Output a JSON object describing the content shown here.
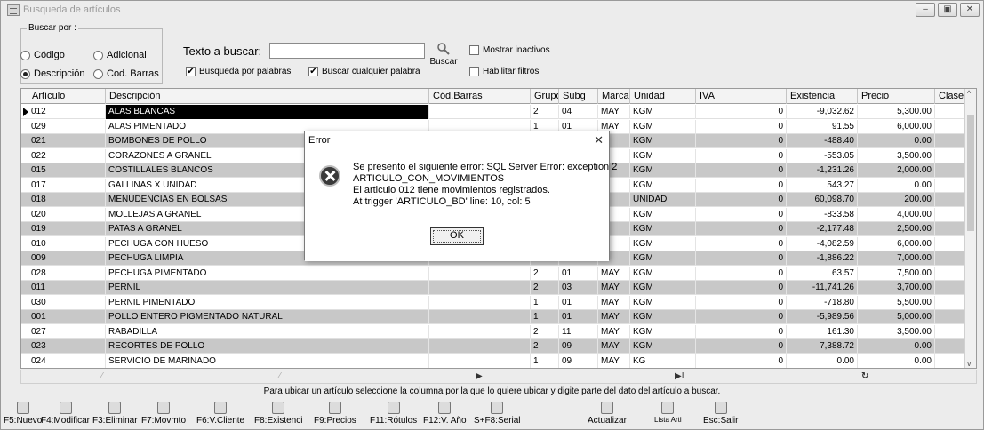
{
  "window": {
    "title": "Busqueda de artículos",
    "controls": [
      "minimize-icon",
      "restore-icon",
      "close-icon"
    ]
  },
  "search": {
    "group_label": "Buscar por :",
    "options": [
      {
        "label": "Código",
        "checked": false
      },
      {
        "label": "Adicional",
        "checked": false
      },
      {
        "label": "Descripción",
        "checked": true
      },
      {
        "label": "Cod. Barras",
        "checked": false
      }
    ],
    "text_label": "Texto a buscar:",
    "text_value": "",
    "by_words_label": "Busqueda por palabras",
    "by_words_checked": true,
    "any_word_label": "Buscar cualquier palabra",
    "any_word_checked": true,
    "button_label": "Buscar",
    "show_inactive_label": "Mostrar inactivos",
    "show_inactive_checked": false,
    "filters_label": "Habilitar filtros",
    "filters_checked": false
  },
  "grid": {
    "columns": [
      "Artículo",
      "Descripción",
      "Cód.Barras",
      "Grupo",
      "Subg",
      "Marca",
      "Unidad",
      "IVA",
      "Existencia",
      "Precio",
      "Clase"
    ],
    "rows": [
      {
        "articulo": "012",
        "descripcion": "ALAS BLANCAS",
        "barras": "",
        "grupo": "2",
        "subg": "04",
        "marca": "MAY",
        "unidad": "KGM",
        "iva": "0",
        "existencia": "-9,032.62",
        "precio": "5,300.00"
      },
      {
        "articulo": "029",
        "descripcion": "ALAS PIMENTADO",
        "barras": "",
        "grupo": "1",
        "subg": "01",
        "marca": "MAY",
        "unidad": "KGM",
        "iva": "0",
        "existencia": "91.55",
        "precio": "6,000.00"
      },
      {
        "articulo": "021",
        "descripcion": "BOMBONES DE POLLO",
        "barras": "",
        "grupo": "",
        "subg": "",
        "marca": "Y",
        "unidad": "KGM",
        "iva": "0",
        "existencia": "-488.40",
        "precio": "0.00"
      },
      {
        "articulo": "022",
        "descripcion": "CORAZONES A GRANEL",
        "barras": "",
        "grupo": "",
        "subg": "",
        "marca": "Y",
        "unidad": "KGM",
        "iva": "0",
        "existencia": "-553.05",
        "precio": "3,500.00"
      },
      {
        "articulo": "015",
        "descripcion": "COSTILLALES BLANCOS",
        "barras": "",
        "grupo": "",
        "subg": "",
        "marca": "Y",
        "unidad": "KGM",
        "iva": "0",
        "existencia": "-1,231.26",
        "precio": "2,000.00"
      },
      {
        "articulo": "017",
        "descripcion": "GALLINAS X UNIDAD",
        "barras": "",
        "grupo": "",
        "subg": "",
        "marca": "Y",
        "unidad": "KGM",
        "iva": "0",
        "existencia": "543.27",
        "precio": "0.00"
      },
      {
        "articulo": "018",
        "descripcion": "MENUDENCIAS EN BOLSAS",
        "barras": "",
        "grupo": "",
        "subg": "",
        "marca": "Y",
        "unidad": "UNIDAD",
        "iva": "0",
        "existencia": "60,098.70",
        "precio": "200.00"
      },
      {
        "articulo": "020",
        "descripcion": "MOLLEJAS A GRANEL",
        "barras": "",
        "grupo": "",
        "subg": "",
        "marca": "Y",
        "unidad": "KGM",
        "iva": "0",
        "existencia": "-833.58",
        "precio": "4,000.00"
      },
      {
        "articulo": "019",
        "descripcion": "PATAS  A GRANEL",
        "barras": "",
        "grupo": "",
        "subg": "",
        "marca": "Y",
        "unidad": "KGM",
        "iva": "0",
        "existencia": "-2,177.48",
        "precio": "2,500.00"
      },
      {
        "articulo": "010",
        "descripcion": "PECHUGA CON HUESO",
        "barras": "",
        "grupo": "",
        "subg": "",
        "marca": "Y",
        "unidad": "KGM",
        "iva": "0",
        "existencia": "-4,082.59",
        "precio": "6,000.00"
      },
      {
        "articulo": "009",
        "descripcion": "PECHUGA LIMPIA",
        "barras": "",
        "grupo": "",
        "subg": "",
        "marca": "Y",
        "unidad": "KGM",
        "iva": "0",
        "existencia": "-1,886.22",
        "precio": "7,000.00"
      },
      {
        "articulo": "028",
        "descripcion": "PECHUGA PIMENTADO",
        "barras": "",
        "grupo": "2",
        "subg": "01",
        "marca": "MAY",
        "unidad": "KGM",
        "iva": "0",
        "existencia": "63.57",
        "precio": "7,500.00"
      },
      {
        "articulo": "011",
        "descripcion": "PERNIL",
        "barras": "",
        "grupo": "2",
        "subg": "03",
        "marca": "MAY",
        "unidad": "KGM",
        "iva": "0",
        "existencia": "-11,741.26",
        "precio": "3,700.00"
      },
      {
        "articulo": "030",
        "descripcion": "PERNIL PIMENTADO",
        "barras": "",
        "grupo": "1",
        "subg": "01",
        "marca": "MAY",
        "unidad": "KGM",
        "iva": "0",
        "existencia": "-718.80",
        "precio": "5,500.00"
      },
      {
        "articulo": "001",
        "descripcion": "POLLO ENTERO PIGMENTADO NATURAL",
        "barras": "",
        "grupo": "1",
        "subg": "01",
        "marca": "MAY",
        "unidad": "KGM",
        "iva": "0",
        "existencia": "-5,989.56",
        "precio": "5,000.00"
      },
      {
        "articulo": "027",
        "descripcion": "RABADILLA",
        "barras": "",
        "grupo": "2",
        "subg": "11",
        "marca": "MAY",
        "unidad": "KGM",
        "iva": "0",
        "existencia": "161.30",
        "precio": "3,500.00"
      },
      {
        "articulo": "023",
        "descripcion": "RECORTES DE POLLO",
        "barras": "",
        "grupo": "2",
        "subg": "09",
        "marca": "MAY",
        "unidad": "KGM",
        "iva": "0",
        "existencia": "7,388.72",
        "precio": "0.00"
      },
      {
        "articulo": "024",
        "descripcion": "SERVICIO DE MARINADO",
        "barras": "",
        "grupo": "1",
        "subg": "09",
        "marca": "MAY",
        "unidad": "KG",
        "iva": "0",
        "existencia": "0.00",
        "precio": "0.00"
      }
    ]
  },
  "navigator": {
    "prev": "▶",
    "last": "▶I",
    "refresh": "↻"
  },
  "hint": "Para ubicar un artículo seleccione la columna por la que lo quiere ubicar y digite parte del dato del artículo a buscar.",
  "toolbar": [
    {
      "label": "F5:Nuevo",
      "icon": "new-icon"
    },
    {
      "label": "F4:Modificar",
      "icon": "edit-icon"
    },
    {
      "label": "F3:Eliminar",
      "icon": "delete-icon"
    },
    {
      "label": "F7:Movmto",
      "icon": "movement-icon"
    },
    {
      "label": "F6:V.Cliente",
      "icon": "client-icon"
    },
    {
      "label": "F8:Existenci",
      "icon": "stock-icon"
    },
    {
      "label": "F9:Precios",
      "icon": "prices-icon"
    },
    {
      "label": "F11:Rótulos",
      "icon": "labels-icon"
    },
    {
      "label": "F12:V. Año",
      "icon": "year-icon"
    },
    {
      "label": "S+F8:Serial",
      "icon": "serial-icon"
    },
    {
      "label": "Actualizar",
      "icon": "refresh-icon"
    },
    {
      "label": "Lista Arti",
      "icon": "list-icon"
    },
    {
      "label": "Esc:Salir",
      "icon": "exit-icon"
    }
  ],
  "dialog": {
    "title": "Error",
    "close": "✕",
    "lines": [
      "Se presento el siguiente error: SQL Server Error: exception 2",
      "ARTICULO_CON_MOVIMIENTOS",
      "El articulo 012 tiene movimientos registrados.",
      "At trigger 'ARTICULO_BD' line: 10, col: 5"
    ],
    "ok_label": "OK"
  }
}
